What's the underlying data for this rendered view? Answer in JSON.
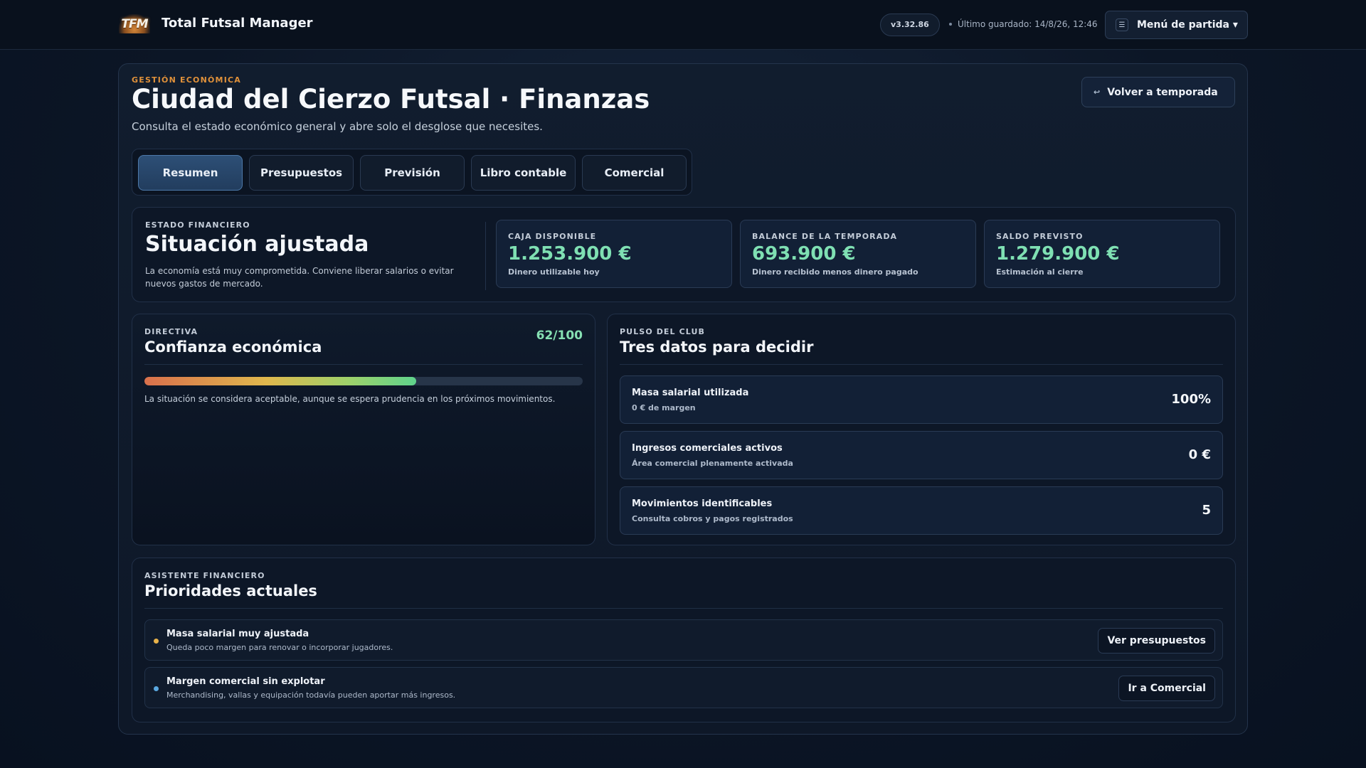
{
  "app": {
    "logo_text": "TFM",
    "title": "Total Futsal Manager",
    "version": "v3.32.86",
    "last_saved": "Último guardado: 14/8/26, 12:46",
    "menu_label": "Menú de partida ▾",
    "menu_icon": "☰"
  },
  "header": {
    "eyebrow": "GESTIÓN ECONÓMICA",
    "title": "Ciudad del Cierzo Futsal · Finanzas",
    "subtitle": "Consulta el estado económico general y abre solo el desglose que necesites.",
    "back_label": "Volver a temporada",
    "back_icon": "↩"
  },
  "tabs": [
    {
      "label": "Resumen",
      "active": true
    },
    {
      "label": "Presupuestos",
      "active": false
    },
    {
      "label": "Previsión",
      "active": false
    },
    {
      "label": "Libro contable",
      "active": false
    },
    {
      "label": "Comercial",
      "active": false
    }
  ],
  "status": {
    "label": "ESTADO FINANCIERO",
    "title": "Situación ajustada",
    "description": "La economía está muy comprometida. Conviene liberar salarios o evitar nuevos gastos de mercado.",
    "metrics": [
      {
        "label": "CAJA DISPONIBLE",
        "value": "1.253.900 €",
        "sub": "Dinero utilizable hoy"
      },
      {
        "label": "BALANCE DE LA TEMPORADA",
        "value": "693.900 €",
        "sub": "Dinero recibido menos dinero pagado"
      },
      {
        "label": "SALDO PREVISTO",
        "value": "1.279.900 €",
        "sub": "Estimación al cierre"
      }
    ]
  },
  "board": {
    "label": "DIRECTIVA",
    "title": "Confianza económica",
    "score": "62/100",
    "score_value": 62,
    "score_max": 100,
    "description": "La situación se considera aceptable, aunque se espera prudencia en los próximos movimientos."
  },
  "pulse": {
    "label": "PULSO DEL CLUB",
    "title": "Tres datos para decidir",
    "rows": [
      {
        "name": "Masa salarial utilizada",
        "note": "0 € de margen",
        "value": "100%"
      },
      {
        "name": "Ingresos comerciales activos",
        "note": "Área comercial plenamente activada",
        "value": "0 €"
      },
      {
        "name": "Movimientos identificables",
        "note": "Consulta cobros y pagos registrados",
        "value": "5"
      }
    ]
  },
  "assistant": {
    "label": "ASISTENTE FINANCIERO",
    "title": "Prioridades actuales",
    "items": [
      {
        "name": "Masa salarial muy ajustada",
        "note": "Queda poco margen para renovar o incorporar jugadores.",
        "action": "Ver presupuestos",
        "bullet_color": "#e8b24a"
      },
      {
        "name": "Margen comercial sin explotar",
        "note": "Merchandising, vallas y equipación todavía pueden aportar más ingresos.",
        "action": "Ir a Comercial",
        "bullet_color": "#5aa8e0"
      }
    ]
  },
  "colors": {
    "accent_orange": "#e0913a",
    "positive_green": "#7fe0b3",
    "active_tab": "#2d4f76"
  }
}
